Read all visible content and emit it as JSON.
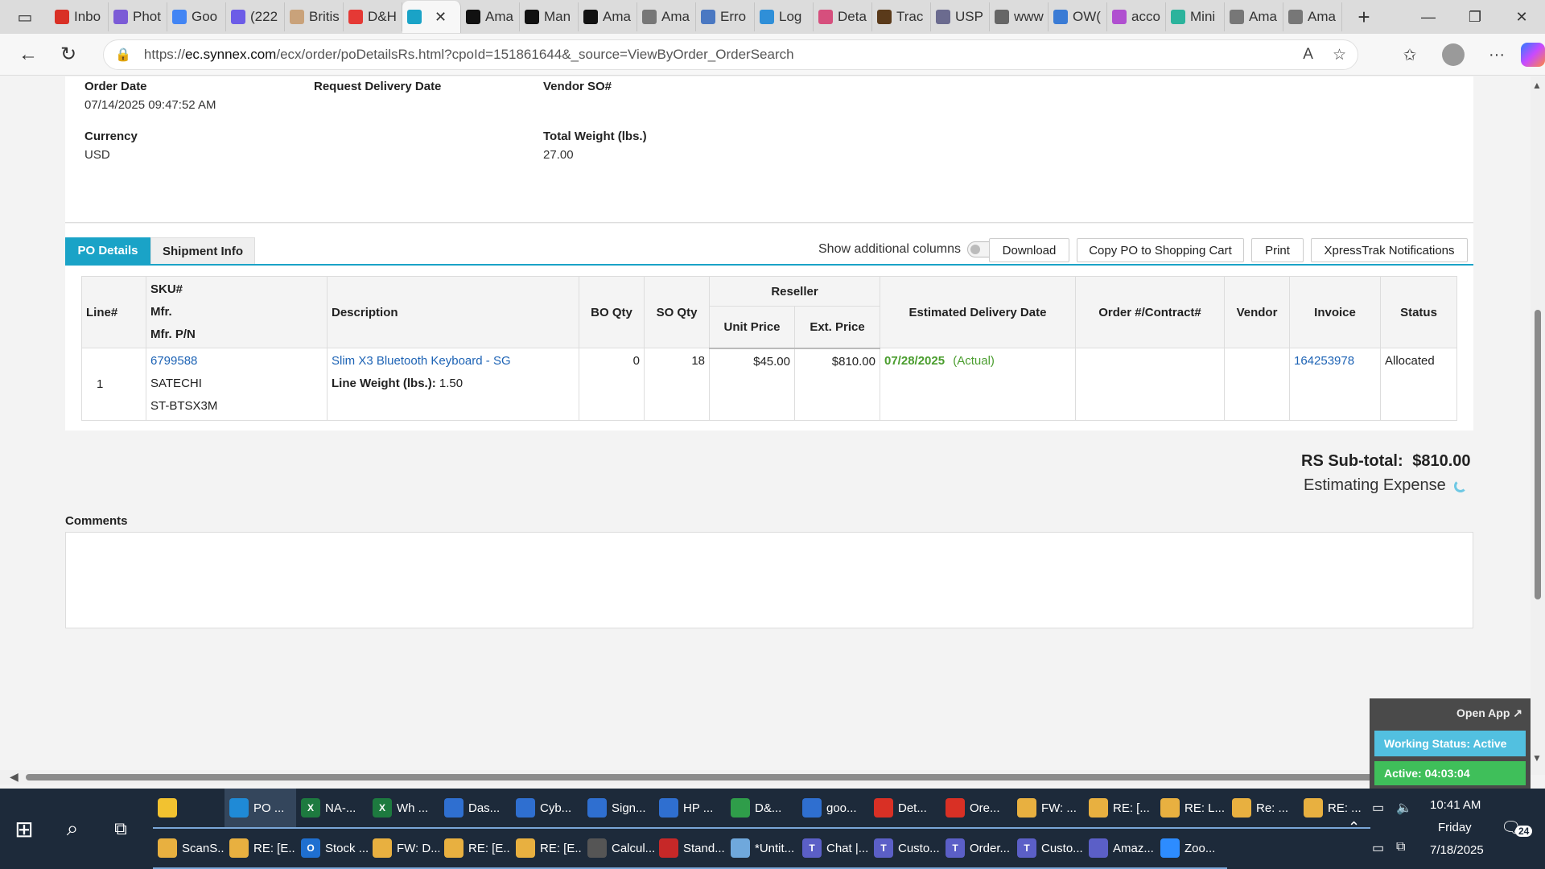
{
  "browser": {
    "tabs": [
      {
        "label": "Inbo",
        "color": "#d93025"
      },
      {
        "label": "Phot",
        "color": "#7b5bd6"
      },
      {
        "label": "Goo",
        "color": "#4285f4"
      },
      {
        "label": "(222",
        "color": "#6c5ce7"
      },
      {
        "label": "Britis",
        "color": "#c9a27a"
      },
      {
        "label": "D&H",
        "color": "#e53935"
      },
      {
        "label": "",
        "color": "#1aa3c7",
        "active": true
      },
      {
        "label": "Ama",
        "color": "#111111"
      },
      {
        "label": "Man",
        "color": "#111111"
      },
      {
        "label": "Ama",
        "color": "#111111"
      },
      {
        "label": "Ama",
        "color": "#777777"
      },
      {
        "label": "Erro",
        "color": "#4a78c2"
      },
      {
        "label": "Log",
        "color": "#2f8fd8"
      },
      {
        "label": "Deta",
        "color": "#d64f7d"
      },
      {
        "label": "Trac",
        "color": "#5a3a1a"
      },
      {
        "label": "USP",
        "color": "#6b6b8f"
      },
      {
        "label": "www",
        "color": "#666666"
      },
      {
        "label": "OW(",
        "color": "#3a7bd5"
      },
      {
        "label": "acco",
        "color": "#b04fd0"
      },
      {
        "label": "Mini",
        "color": "#2bb39c"
      },
      {
        "label": "Ama",
        "color": "#777777"
      },
      {
        "label": "Ama",
        "color": "#777777"
      }
    ],
    "active_tab_close": "✕",
    "new_tab": "+",
    "url_prefix": "https://",
    "url_host": "ec.synnex.com",
    "url_path": "/ecx/order/poDetailsRs.html?cpoId=151861644&_source=ViewByOrder_OrderSearch"
  },
  "order": {
    "order_date_label": "Order Date",
    "order_date": "07/14/2025 09:47:52 AM",
    "request_delivery_label": "Request Delivery Date",
    "request_delivery": "",
    "vendor_so_label": "Vendor SO#",
    "vendor_so": "",
    "currency_label": "Currency",
    "currency": "USD",
    "total_weight_label": "Total Weight (lbs.)",
    "total_weight": "27.00"
  },
  "actions": {
    "show_columns": "Show additional columns",
    "download": "Download",
    "copy_po": "Copy PO to Shopping Cart",
    "print": "Print",
    "xpresstrak": "XpressTrak Notifications"
  },
  "tabs": {
    "po_details": "PO Details",
    "shipment_info": "Shipment Info"
  },
  "table": {
    "headers": {
      "line": "Line#",
      "sku": "SKU#",
      "mfr": "Mfr.",
      "mfr_pn": "Mfr. P/N",
      "description": "Description",
      "bo_qty": "BO Qty",
      "so_qty": "SO Qty",
      "reseller": "Reseller",
      "unit_price": "Unit Price",
      "ext_price": "Ext. Price",
      "est_delivery": "Estimated Delivery Date",
      "order_contract": "Order #/Contract#",
      "vendor": "Vendor",
      "invoice": "Invoice",
      "status": "Status"
    },
    "rows": [
      {
        "line": "1",
        "sku": "6799588",
        "mfr": "SATECHI",
        "mfr_pn": "ST-BTSX3M",
        "description": "Slim X3 Bluetooth Keyboard - SG",
        "line_weight_label": "Line Weight (lbs.):",
        "line_weight": "1.50",
        "bo_qty": "0",
        "so_qty": "18",
        "unit_price": "$45.00",
        "ext_price": "$810.00",
        "est_date": "07/28/2025",
        "est_note": "(Actual)",
        "order_contract": "",
        "vendor": "",
        "invoice": "164253978",
        "status": "Allocated"
      }
    ]
  },
  "totals": {
    "subtotal_label": "RS Sub-total:",
    "subtotal": "$810.00",
    "estimating": "Estimating Expense"
  },
  "comments": {
    "label": "Comments"
  },
  "widget": {
    "open_app": "Open App ↗",
    "working_status": "Working Status: Active",
    "active_time": "Active: 04:03:04"
  },
  "taskbar": {
    "row1": [
      {
        "label": "",
        "icon": "folder",
        "color": "#f2c230"
      },
      {
        "label": "PO ...",
        "icon": "edge",
        "color": "#1f8ad6",
        "active": true
      },
      {
        "label": "NA-...",
        "icon": "X",
        "color": "#1d7a3f"
      },
      {
        "label": "Wh ...",
        "icon": "X",
        "color": "#1d7a3f"
      },
      {
        "label": "Das...",
        "icon": "chrome",
        "color": "#2f6fd0"
      },
      {
        "label": "Cyb...",
        "icon": "chrome",
        "color": "#2f6fd0"
      },
      {
        "label": "Sign...",
        "icon": "chrome",
        "color": "#2f6fd0"
      },
      {
        "label": "HP ...",
        "icon": "chrome",
        "color": "#2f6fd0"
      },
      {
        "label": "D&...",
        "icon": "chrome",
        "color": "#2f9d4a"
      },
      {
        "label": "goo...",
        "icon": "chrome",
        "color": "#2f6fd0"
      },
      {
        "label": "Det...",
        "icon": "chrome",
        "color": "#d93025"
      },
      {
        "label": "Ore...",
        "icon": "chrome",
        "color": "#d93025"
      },
      {
        "label": "FW: ...",
        "icon": "mail",
        "color": "#e8b040"
      },
      {
        "label": "RE: [...",
        "icon": "mail",
        "color": "#e8b040"
      },
      {
        "label": "RE: L...",
        "icon": "mail",
        "color": "#e8b040"
      },
      {
        "label": "Re: ...",
        "icon": "mail",
        "color": "#e8b040"
      },
      {
        "label": "RE: ...",
        "icon": "mail",
        "color": "#e8b040"
      }
    ],
    "row2": [
      {
        "label": "ScanS...",
        "icon": "mail",
        "color": "#e8b040"
      },
      {
        "label": "RE: [E...",
        "icon": "mail",
        "color": "#e8b040"
      },
      {
        "label": "Stock ...",
        "icon": "O",
        "color": "#1f6fd0"
      },
      {
        "label": "FW: D...",
        "icon": "mail",
        "color": "#e8b040"
      },
      {
        "label": "RE: [E...",
        "icon": "mail",
        "color": "#e8b040"
      },
      {
        "label": "RE: [E...",
        "icon": "mail",
        "color": "#e8b040"
      },
      {
        "label": "Calcul...",
        "icon": "calc",
        "color": "#555555"
      },
      {
        "label": "Stand...",
        "icon": "pdf",
        "color": "#c62828"
      },
      {
        "label": "*Untit...",
        "icon": "note",
        "color": "#6fa8dc"
      },
      {
        "label": "Chat |...",
        "icon": "T",
        "color": "#5b5fc7"
      },
      {
        "label": "Custo...",
        "icon": "T",
        "color": "#5b5fc7"
      },
      {
        "label": "Order...",
        "icon": "T",
        "color": "#5b5fc7"
      },
      {
        "label": "Custo...",
        "icon": "T",
        "color": "#5b5fc7"
      },
      {
        "label": "Amaz...",
        "icon": "teams",
        "color": "#5b5fc7"
      },
      {
        "label": "Zoo...",
        "icon": "zoom",
        "color": "#2d8cff"
      }
    ],
    "time": "10:41 AM",
    "day": "Friday",
    "date": "7/18/2025",
    "notifications": "24"
  }
}
